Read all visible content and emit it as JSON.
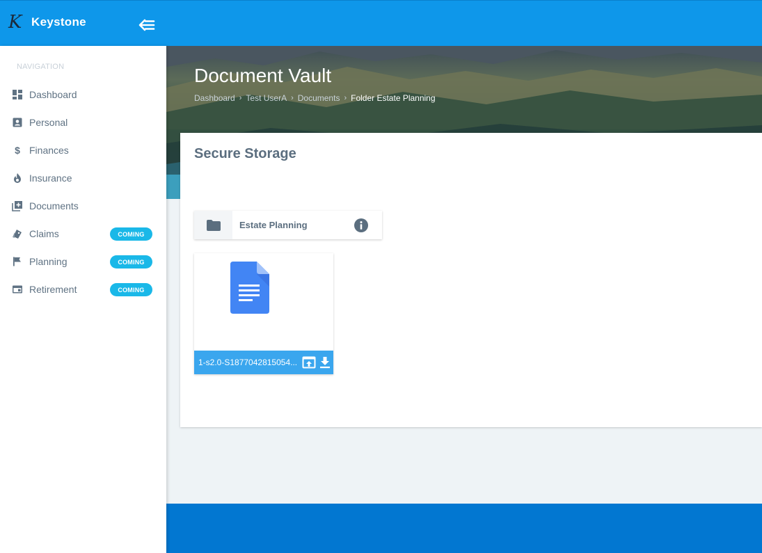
{
  "brand": {
    "logo_letter": "K",
    "name": "Keystone"
  },
  "topbar": {
    "collapse_icon": "arrow-left-collapse-icon"
  },
  "sidebar": {
    "heading": "NAVIGATION",
    "items": [
      {
        "label": "Dashboard",
        "icon": "dashboard-icon"
      },
      {
        "label": "Personal",
        "icon": "contact-card-icon"
      },
      {
        "label": "Finances",
        "icon": "dollar-icon"
      },
      {
        "label": "Insurance",
        "icon": "flame-icon"
      },
      {
        "label": "Documents",
        "icon": "library-add-icon"
      },
      {
        "label": "Claims",
        "icon": "tags-icon",
        "badge": "COMING"
      },
      {
        "label": "Planning",
        "icon": "flag-icon",
        "badge": "COMING"
      },
      {
        "label": "Retirement",
        "icon": "card-icon",
        "badge": "COMING"
      }
    ]
  },
  "header": {
    "title": "Document Vault",
    "breadcrumb": [
      "Dashboard",
      "Test UserA",
      "Documents",
      "Folder Estate Planning"
    ]
  },
  "main": {
    "section_title": "Secure Storage",
    "folder": {
      "name": "Estate Planning"
    },
    "files": [
      {
        "name": "1-s2.0-S1877042815054..."
      }
    ]
  },
  "colors": {
    "topbar": "#0e97ea",
    "accent": "#3aa6ee",
    "badge": "#1ab8e8",
    "footer": "#0277d1",
    "doc_blue": "#4285f4"
  }
}
